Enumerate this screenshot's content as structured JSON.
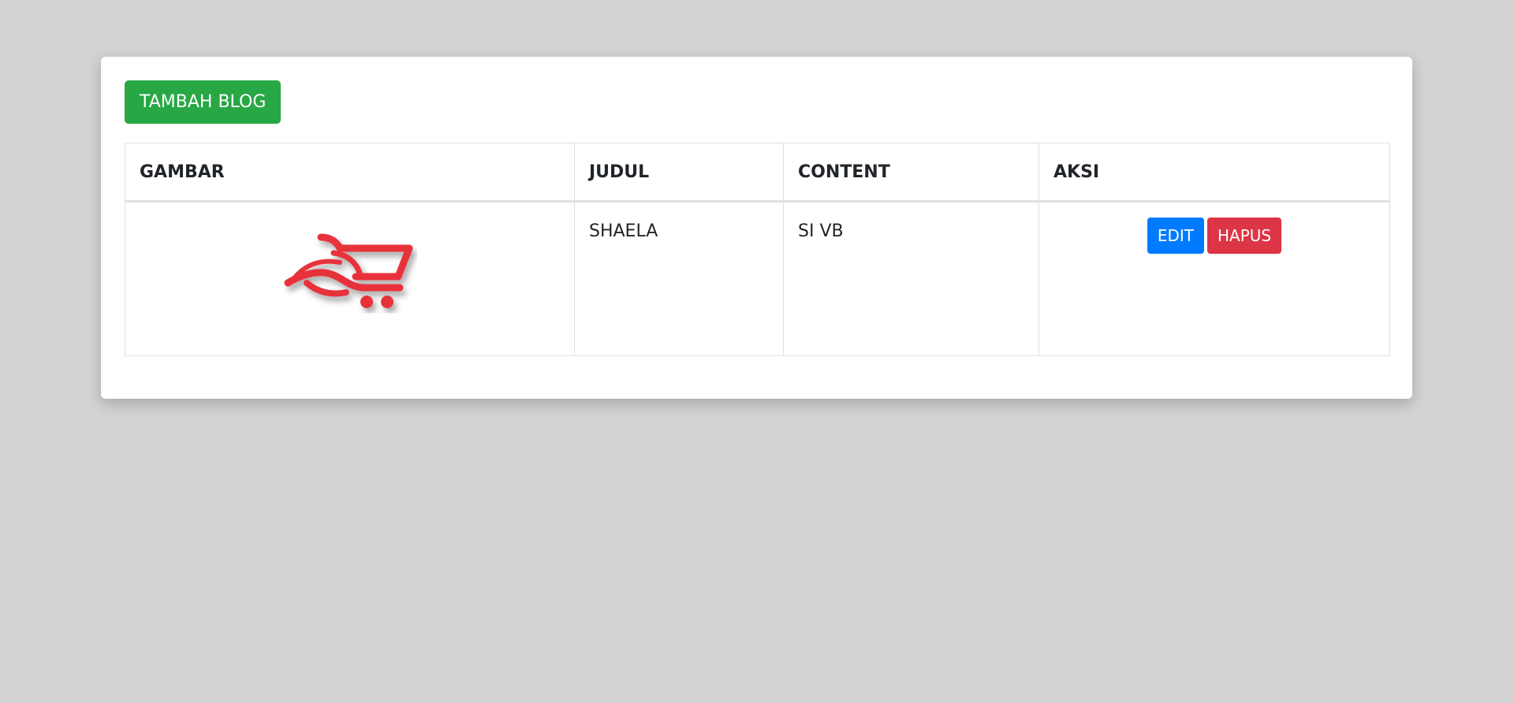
{
  "toolbar": {
    "add_label": "TAMBAH BLOG"
  },
  "table": {
    "headers": [
      "GAMBAR",
      "JUDUL",
      "CONTENT",
      "AKSI"
    ],
    "rows": [
      {
        "image_icon": "shopping-cart-logo",
        "judul": "SHAELA",
        "content": "SI VB",
        "edit_label": "EDIT",
        "delete_label": "HAPUS"
      }
    ]
  },
  "colors": {
    "background": "#d3d3d3",
    "add_button": "#28a745",
    "edit_button": "#007bff",
    "delete_button": "#dc3545",
    "logo": "#e8323a"
  }
}
